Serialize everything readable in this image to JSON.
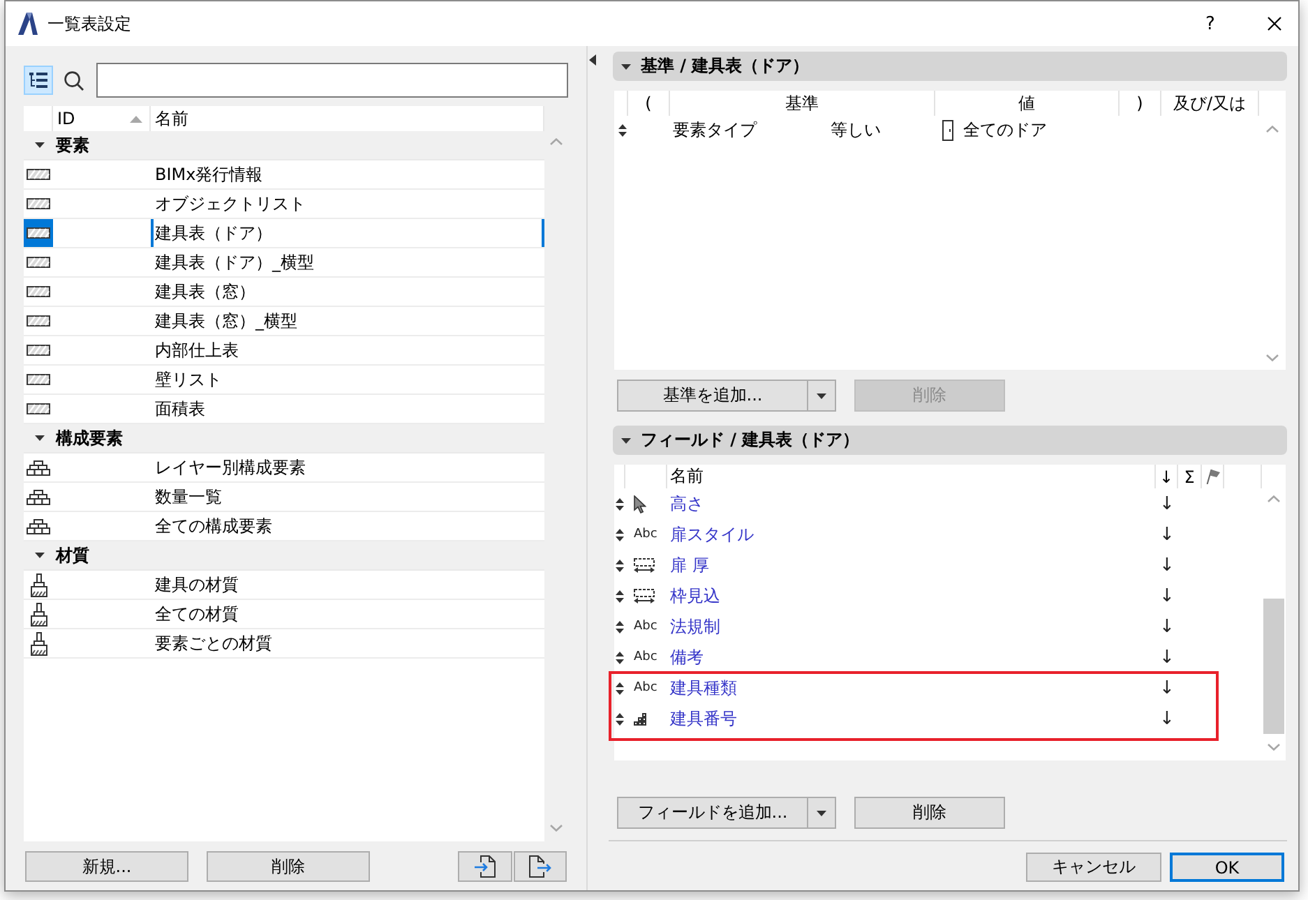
{
  "window": {
    "title": "一覧表設定",
    "help": "?"
  },
  "scheme_list": {
    "columns": [
      {
        "label": "ID",
        "sorted": true
      },
      {
        "label": "名前",
        "sorted": false
      }
    ],
    "groups": [
      {
        "label": "要素",
        "kind": "schedule",
        "expanded": true,
        "items": [
          {
            "name": "BIMx発行情報",
            "selected": false
          },
          {
            "name": "オブジェクトリスト",
            "selected": false
          },
          {
            "name": "建具表（ドア）",
            "selected": true
          },
          {
            "name": "建具表（ドア）_横型",
            "selected": false
          },
          {
            "name": "建具表（窓）",
            "selected": false
          },
          {
            "name": "建具表（窓）_横型",
            "selected": false
          },
          {
            "name": "内部仕上表",
            "selected": false
          },
          {
            "name": "壁リスト",
            "selected": false
          },
          {
            "name": "面積表",
            "selected": false
          }
        ]
      },
      {
        "label": "構成要素",
        "kind": "component",
        "expanded": true,
        "items": [
          {
            "name": "レイヤー別構成要素",
            "selected": false
          },
          {
            "name": "数量一覧",
            "selected": false
          },
          {
            "name": "全ての構成要素",
            "selected": false
          }
        ]
      },
      {
        "label": "材質",
        "kind": "material",
        "expanded": true,
        "items": [
          {
            "name": "建具の材質",
            "selected": false
          },
          {
            "name": "全ての材質",
            "selected": false
          },
          {
            "name": "要素ごとの材質",
            "selected": false
          }
        ]
      }
    ]
  },
  "scheme_buttons": [
    "新規...",
    "削除"
  ],
  "criteria": {
    "title": "基準 / 建具表（ドア）",
    "expanded": true,
    "columns": [
      "(",
      "基準",
      "値",
      ")",
      "及び/又は"
    ],
    "rows": [
      {
        "criterion": "要素タイプ",
        "operator": "等しい",
        "value": "全てのドア"
      }
    ],
    "buttons": [
      {
        "label": "基準を追加...",
        "kind": "split",
        "disabled": false
      },
      {
        "label": "削除",
        "kind": "plain",
        "disabled": true
      }
    ]
  },
  "fields": {
    "title": "フィールド / 建具表（ドア）",
    "expanded": true,
    "columns": {
      "name": "名前",
      "order": "↓",
      "sum": "Σ"
    },
    "rows": [
      {
        "kind": "pointer",
        "name": "高さ",
        "order": "↓",
        "highlighted": false
      },
      {
        "kind": "text",
        "type_label": "Abc",
        "name": "扉スタイル",
        "order": "↓",
        "highlighted": false
      },
      {
        "kind": "dimension",
        "name": "扉 厚",
        "order": "↓",
        "highlighted": false
      },
      {
        "kind": "dimension",
        "name": "枠見込",
        "order": "↓",
        "highlighted": false
      },
      {
        "kind": "text",
        "type_label": "Abc",
        "name": "法規制",
        "order": "↓",
        "highlighted": false
      },
      {
        "kind": "text",
        "type_label": "Abc",
        "name": "備考",
        "order": "↓",
        "highlighted": false
      },
      {
        "kind": "text",
        "type_label": "Abc",
        "name": "建具種類",
        "order": "↓",
        "highlighted": true
      },
      {
        "kind": "number",
        "name": "建具番号",
        "order": "↓",
        "highlighted": true
      }
    ],
    "buttons": [
      {
        "label": "フィールドを追加...",
        "kind": "split",
        "disabled": false
      },
      {
        "label": "削除",
        "kind": "plain",
        "disabled": false
      }
    ]
  },
  "dialog_buttons": [
    {
      "label": "キャンセル",
      "default": false
    },
    {
      "label": "OK",
      "default": true
    }
  ]
}
